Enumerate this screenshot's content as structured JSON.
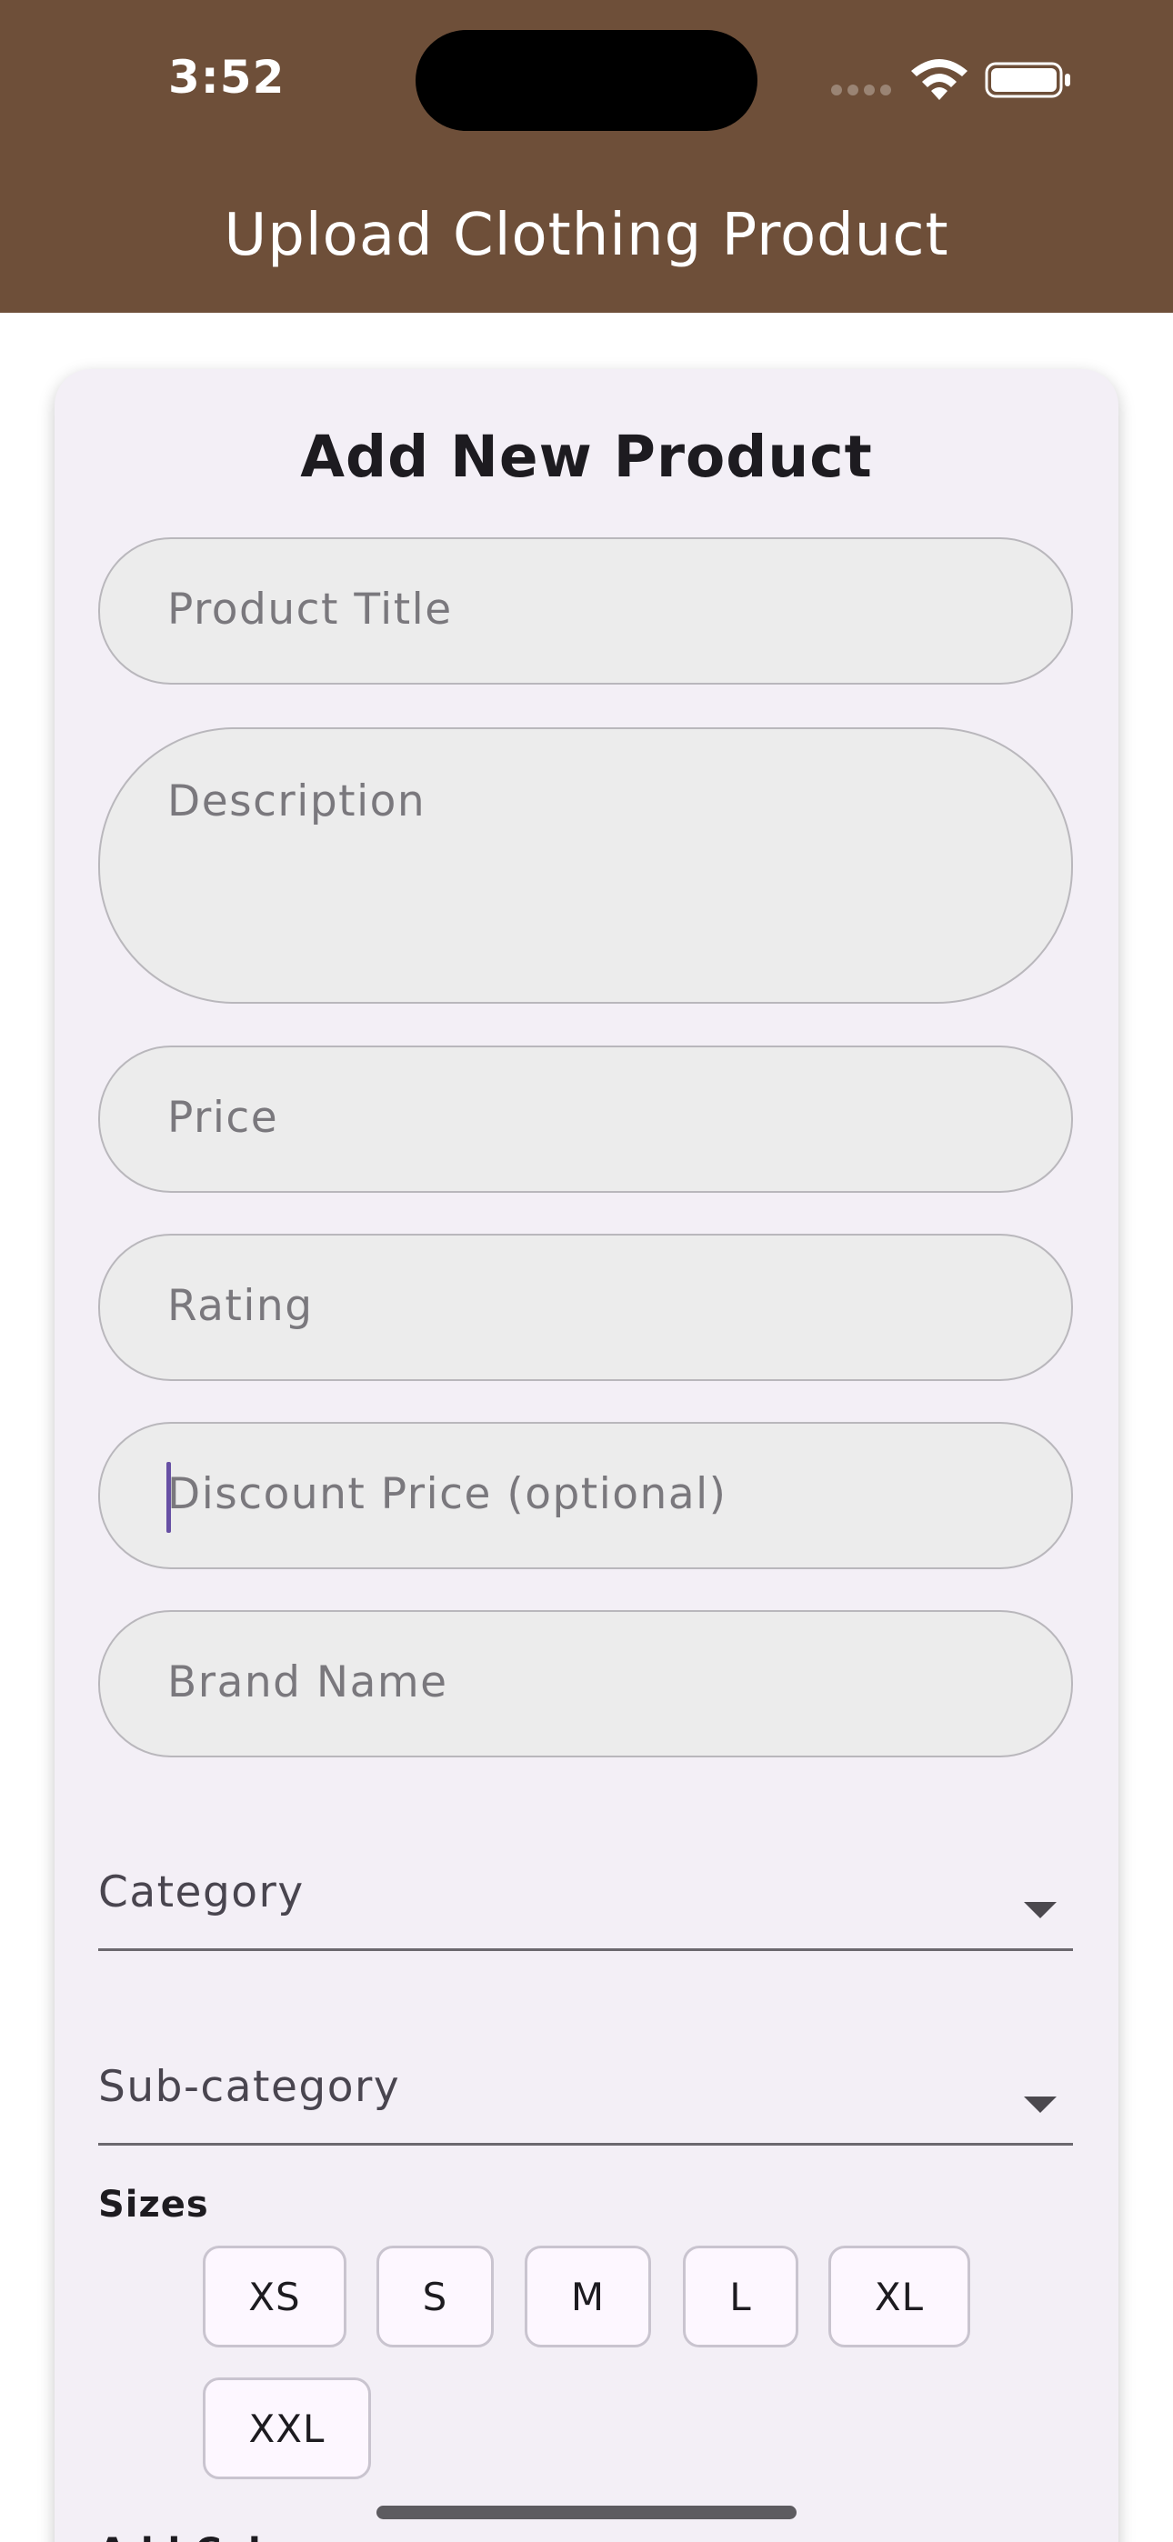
{
  "status_bar": {
    "time": "3:52"
  },
  "app_bar": {
    "title": "Upload Clothing Product",
    "background": "#6e4f39"
  },
  "form": {
    "heading": "Add New Product",
    "fields": {
      "title": {
        "placeholder": "Product Title",
        "value": ""
      },
      "description": {
        "placeholder": "Description",
        "value": ""
      },
      "price": {
        "placeholder": "Price",
        "value": ""
      },
      "rating": {
        "placeholder": "Rating",
        "value": ""
      },
      "discount": {
        "placeholder": "Discount Price (optional)",
        "value": "",
        "focused": true
      },
      "brand": {
        "placeholder": "Brand Name",
        "value": ""
      }
    },
    "category": {
      "label": "Category",
      "icon": "caret-down-icon"
    },
    "subcategory": {
      "label": "Sub-category",
      "icon": "caret-down-icon"
    },
    "sizes": {
      "label": "Sizes",
      "options": [
        "XS",
        "S",
        "M",
        "L",
        "XL",
        "XXL"
      ]
    },
    "next_section_label": "Add Colors"
  },
  "colors": {
    "accent": "#6750a4",
    "card_bg": "#f3eff6",
    "field_bg": "#ececec"
  }
}
